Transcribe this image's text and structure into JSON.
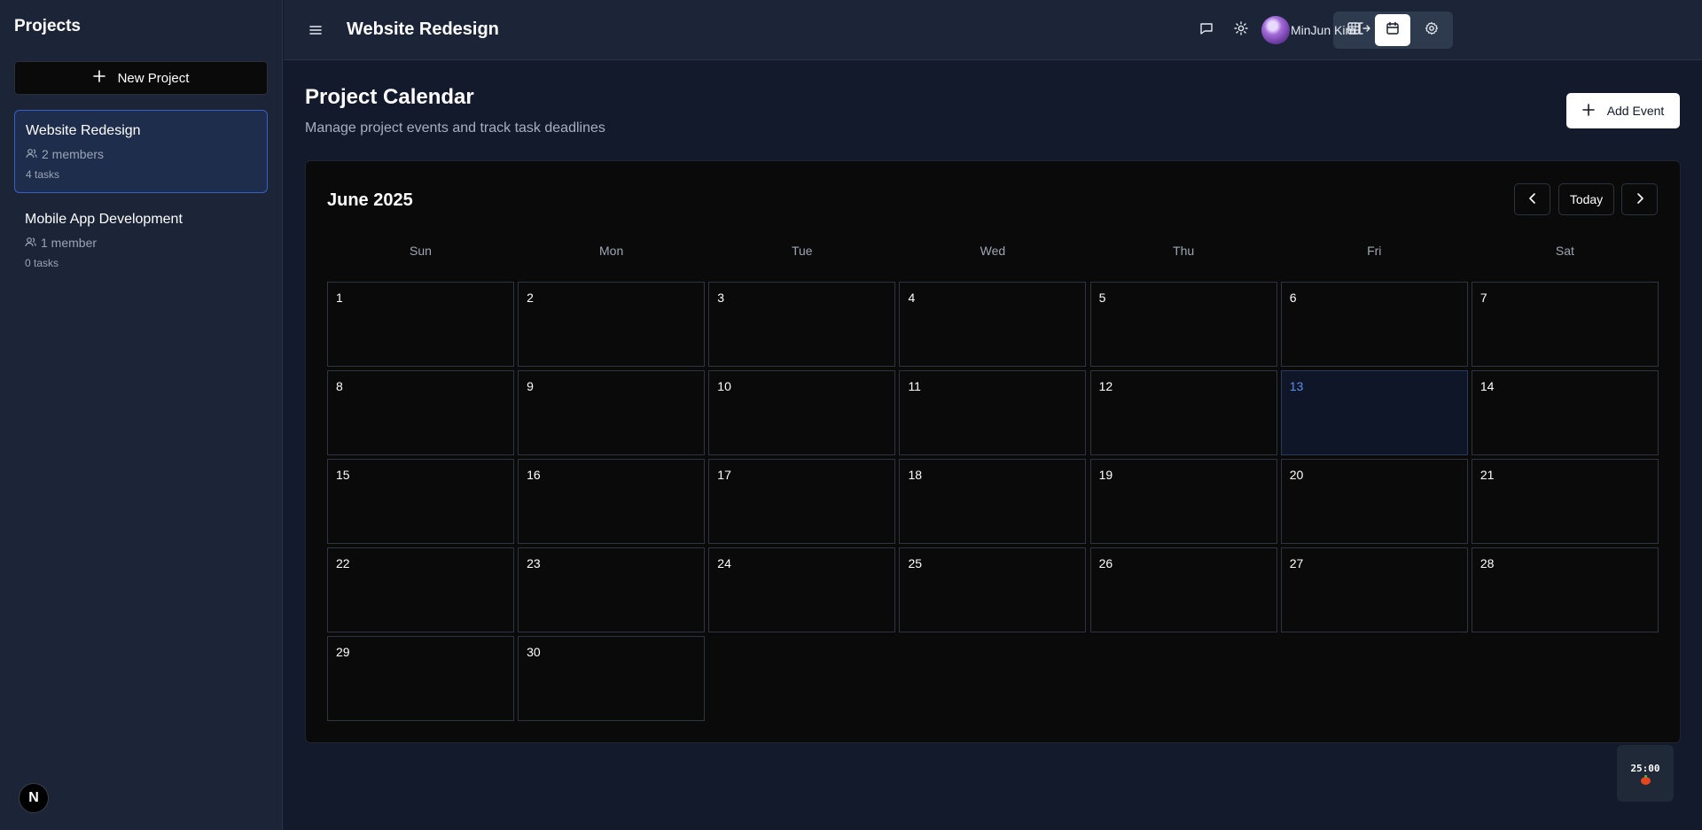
{
  "sidebar": {
    "title": "Projects",
    "new_project_label": "New Project",
    "projects": [
      {
        "name": "Website Redesign",
        "members": "2 members",
        "tasks": "4 tasks",
        "active": true
      },
      {
        "name": "Mobile App Development",
        "members": "1 member",
        "tasks": "0 tasks",
        "active": false
      }
    ],
    "badge": "N"
  },
  "header": {
    "title": "Website Redesign",
    "views": [
      "grid-icon",
      "calendar-icon",
      "gear-icon"
    ],
    "active_view": "calendar-icon",
    "user_name": "MinJun Kim"
  },
  "main": {
    "title": "Project Calendar",
    "subtitle": "Manage project events and track task deadlines",
    "add_event_label": "Add Event"
  },
  "calendar": {
    "month_label": "June 2025",
    "today_label": "Today",
    "weekdays": [
      "Sun",
      "Mon",
      "Tue",
      "Wed",
      "Thu",
      "Fri",
      "Sat"
    ],
    "days_in_month": 30,
    "first_weekday": 0,
    "today": 13
  },
  "timer": {
    "time": "25:00"
  },
  "colors": {
    "accent": "#3a5fc9",
    "today_text": "#5b8ef0",
    "tomato": "#e5461d"
  }
}
